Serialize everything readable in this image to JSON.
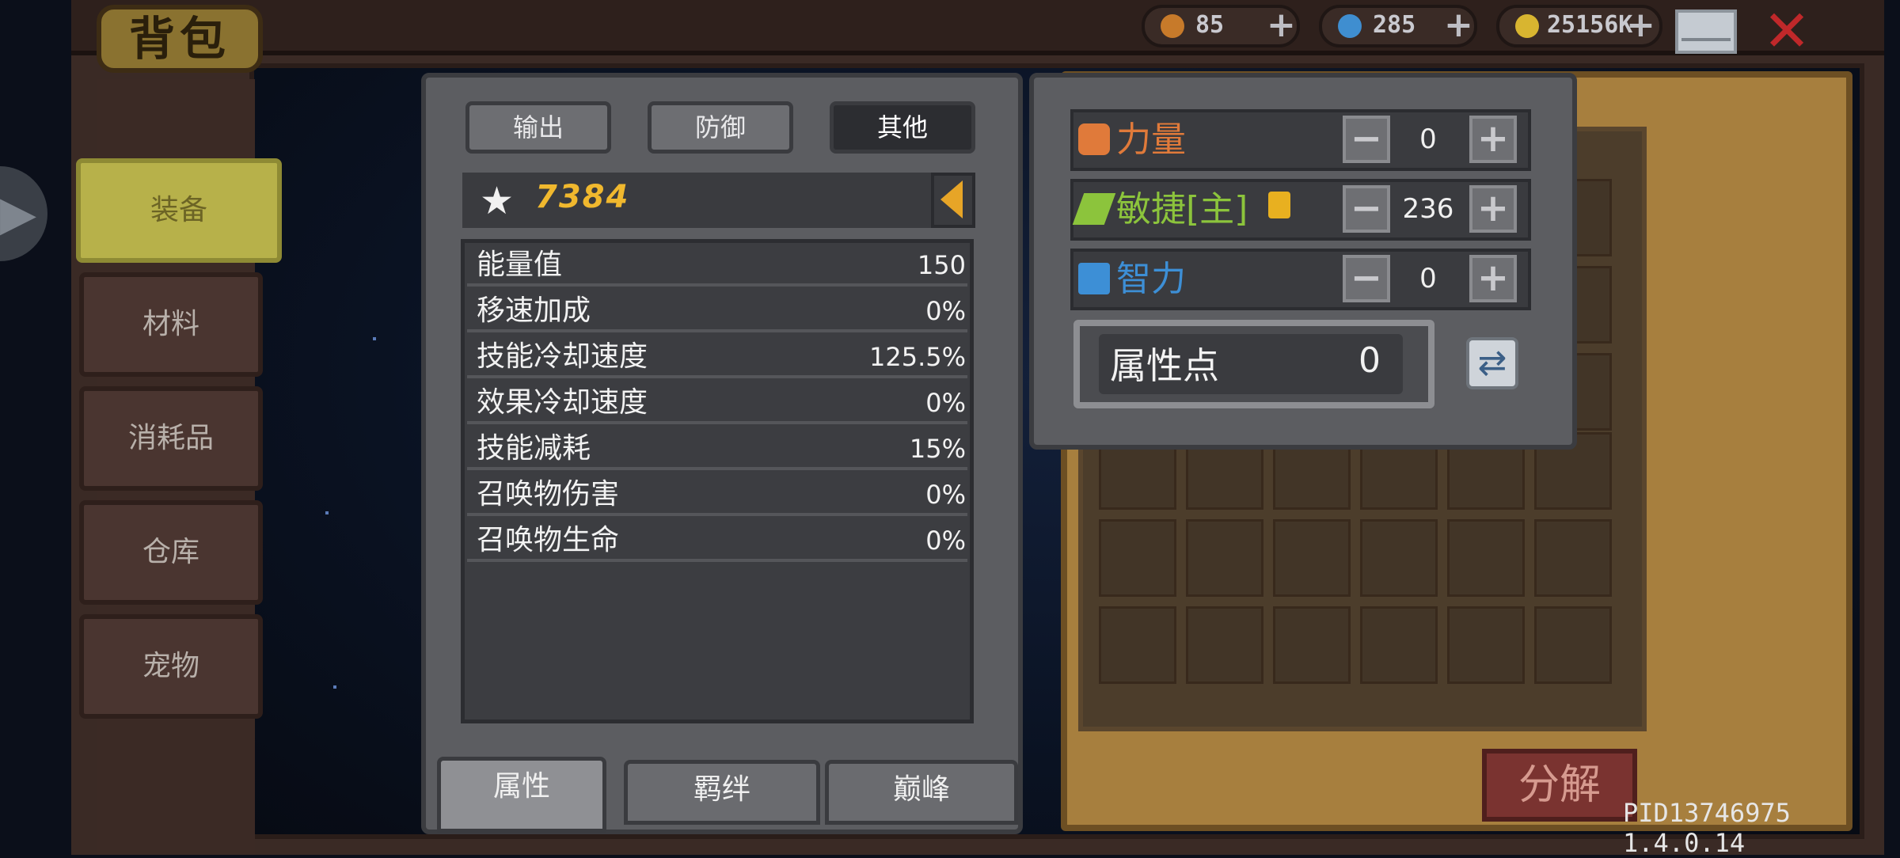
{
  "header": {
    "title": "背包",
    "resources": [
      {
        "icon": "energy-icon",
        "value": "85",
        "color": "#c77a2a"
      },
      {
        "icon": "gem-icon",
        "value": "285",
        "color": "#3f8ed0"
      },
      {
        "icon": "gold-coin-icon",
        "value": "25156K",
        "color": "#d8b530"
      }
    ],
    "plus": "+",
    "close": "✕"
  },
  "sidebar": {
    "expand_arrow": "▶",
    "items": [
      {
        "label": "装备",
        "active": true
      },
      {
        "label": "材料"
      },
      {
        "label": "消耗品"
      },
      {
        "label": "仓库"
      },
      {
        "label": "宠物"
      }
    ]
  },
  "stats_panel": {
    "tabs": [
      {
        "label": "输出"
      },
      {
        "label": "防御"
      },
      {
        "label": "其他",
        "active": true
      }
    ],
    "score": "7384",
    "score_star": "★",
    "rows": [
      {
        "name": "能量值",
        "value": "150"
      },
      {
        "name": "移速加成",
        "value": "0%"
      },
      {
        "name": "技能冷却速度",
        "value": "125.5%"
      },
      {
        "name": "效果冷却速度",
        "value": "0%"
      },
      {
        "name": "技能减耗",
        "value": "15%"
      },
      {
        "name": "召唤物伤害",
        "value": "0%"
      },
      {
        "name": "召唤物生命",
        "value": "0%"
      }
    ],
    "bottom_tabs": [
      {
        "label": "属性",
        "active": true
      },
      {
        "label": "羁绊"
      },
      {
        "label": "巅峰"
      }
    ]
  },
  "attributes": {
    "rows": [
      {
        "label": "力量",
        "value": "0",
        "color": "#e07a3a",
        "icon": "strength-fist-icon"
      },
      {
        "label": "敏捷[主]",
        "value": "236",
        "color": "#8cc43c",
        "icon": "agility-feather-icon"
      },
      {
        "label": "智力",
        "value": "0",
        "color": "#3d8fd6",
        "icon": "intellect-book-icon"
      }
    ],
    "minus": "−",
    "plus": "+",
    "points_label": "属性点",
    "points_value": "0",
    "reset_symbol": "⇄"
  },
  "inventory": {
    "decompose_label": "分解"
  },
  "footer": {
    "pid": "PID13746975 1.4.0.14"
  }
}
